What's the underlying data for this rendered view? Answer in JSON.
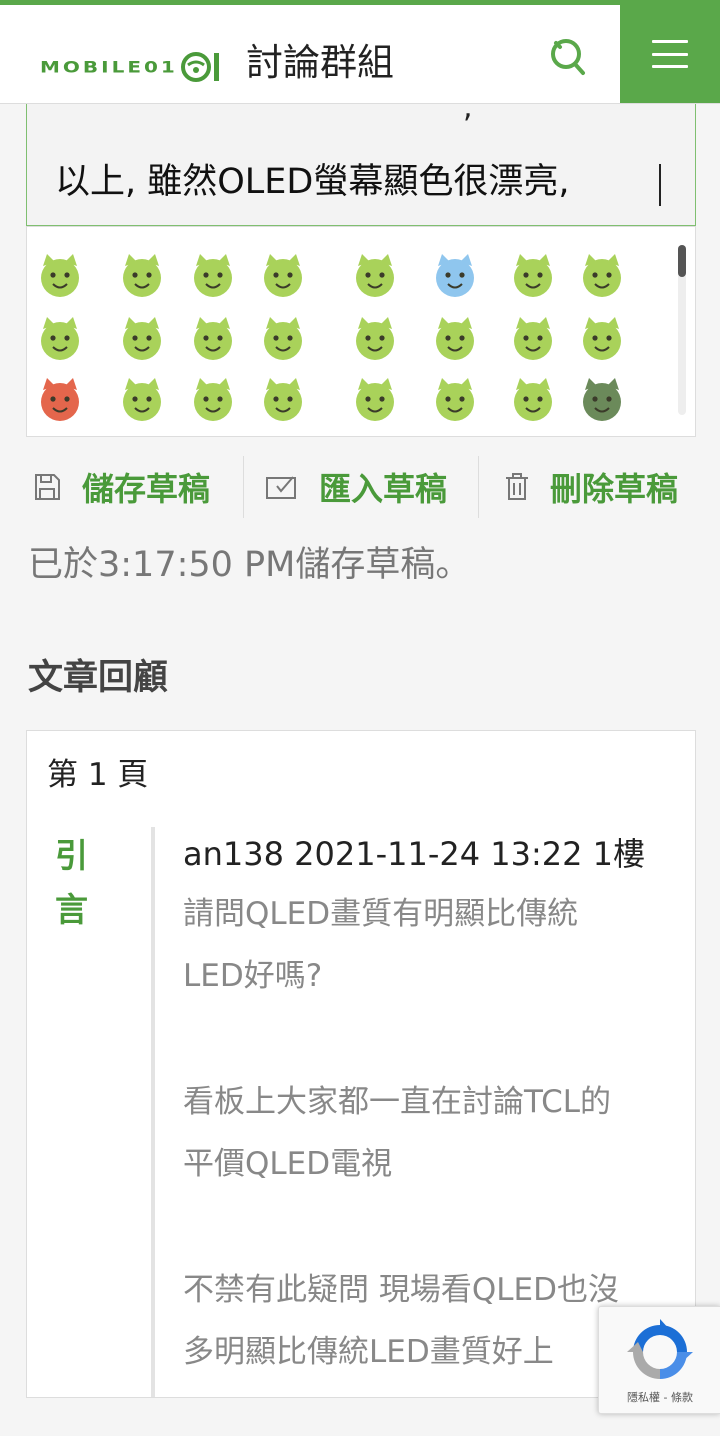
{
  "header": {
    "logo_text": "MOBILE01",
    "title": "討論群組",
    "search_icon": "search-icon",
    "menu_icon": "hamburger-menu-icon"
  },
  "editor": {
    "prev_line_fragment": ",",
    "current_line": "以上, 雖然OLED螢幕顯色很漂亮,"
  },
  "emoji_panel": {
    "rows": [
      [
        "smile",
        "x-eyes",
        "grin",
        "confused",
        "angry-grit",
        "frozen",
        "drool",
        "annoyed"
      ],
      [
        "tongue",
        "dizzy",
        "blush",
        "shocked",
        "crying",
        "wink",
        "smirk",
        "content"
      ],
      [
        "red-angry",
        "nervous",
        "teeth",
        "laugh",
        "shy",
        "glasses",
        "sleepy",
        "gloomy"
      ]
    ]
  },
  "draft_actions": {
    "save_label": "儲存草稿",
    "import_label": "匯入草稿",
    "delete_label": "刪除草稿"
  },
  "saved_message": "已於3:17:50 PM儲存草稿。",
  "review": {
    "title": "文章回顧",
    "page_label": "第 1 頁",
    "quote_label": "引言",
    "post": {
      "meta": "an138  2021-11-24  13:22 1樓",
      "lines": [
        "請問QLED畫質有明顯比傳統",
        "LED好嗎?",
        "看板上大家都一直在討論TCL的",
        "平價QLED電視",
        "不禁有此疑問 現場看QLED也沒",
        "多明顯比傳統LED畫質好上"
      ]
    }
  },
  "recaptcha": {
    "links": "隱私權 - 條款"
  },
  "colors": {
    "brand_green": "#5aa84a",
    "text_green": "#4a9a3a",
    "emoji_green": "#a9d25a"
  }
}
